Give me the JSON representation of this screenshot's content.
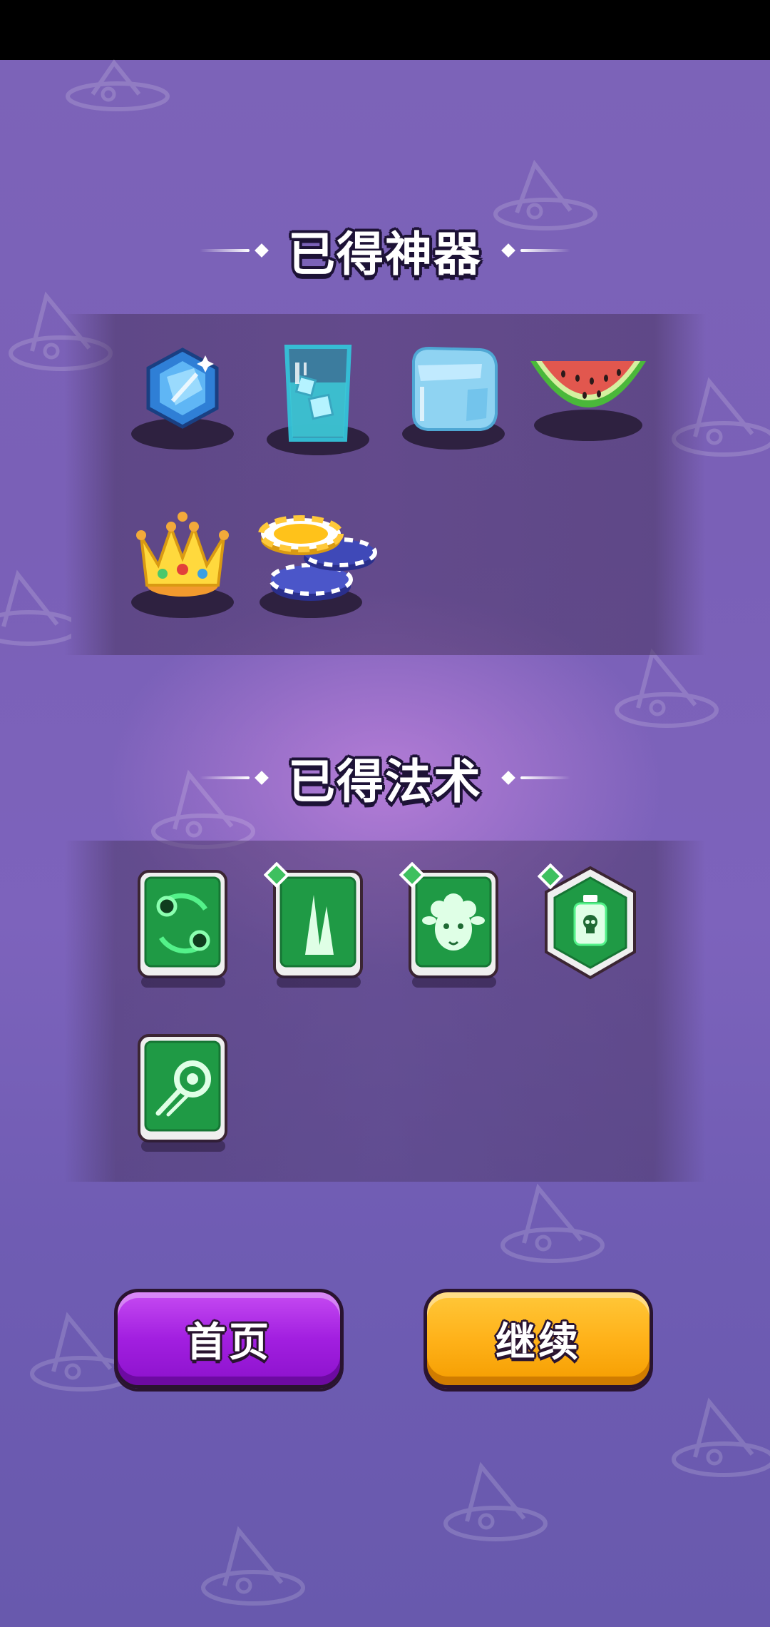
{
  "artifacts_section": {
    "title": "已得神器",
    "items": [
      {
        "name": "blue-gem",
        "icon": "gem-icon"
      },
      {
        "name": "ice-water-glass",
        "icon": "glass-icon"
      },
      {
        "name": "ice-cube",
        "icon": "ice-cube-icon"
      },
      {
        "name": "watermelon-slice",
        "icon": "watermelon-icon"
      },
      {
        "name": "gold-crown",
        "icon": "crown-icon"
      },
      {
        "name": "poker-chips",
        "icon": "chips-icon"
      }
    ]
  },
  "spells_section": {
    "title": "已得法术",
    "items": [
      {
        "name": "orbit-spell",
        "icon": "orbit-icon",
        "upgraded": false,
        "frame": "square"
      },
      {
        "name": "spikes-spell",
        "icon": "spikes-icon",
        "upgraded": true,
        "frame": "square"
      },
      {
        "name": "sheep-spell",
        "icon": "sheep-icon",
        "upgraded": true,
        "frame": "square"
      },
      {
        "name": "poison-spell",
        "icon": "poison-bottle-icon",
        "upgraded": true,
        "frame": "hexagon"
      },
      {
        "name": "dash-spell",
        "icon": "dash-icon",
        "upgraded": false,
        "frame": "square"
      }
    ]
  },
  "buttons": {
    "home_label": "首页",
    "continue_label": "继续"
  },
  "colors": {
    "background": "#7c63b8",
    "home_button": "#a21fe0",
    "continue_button": "#ffb21a",
    "spell_card_green": "#1f9a45"
  }
}
